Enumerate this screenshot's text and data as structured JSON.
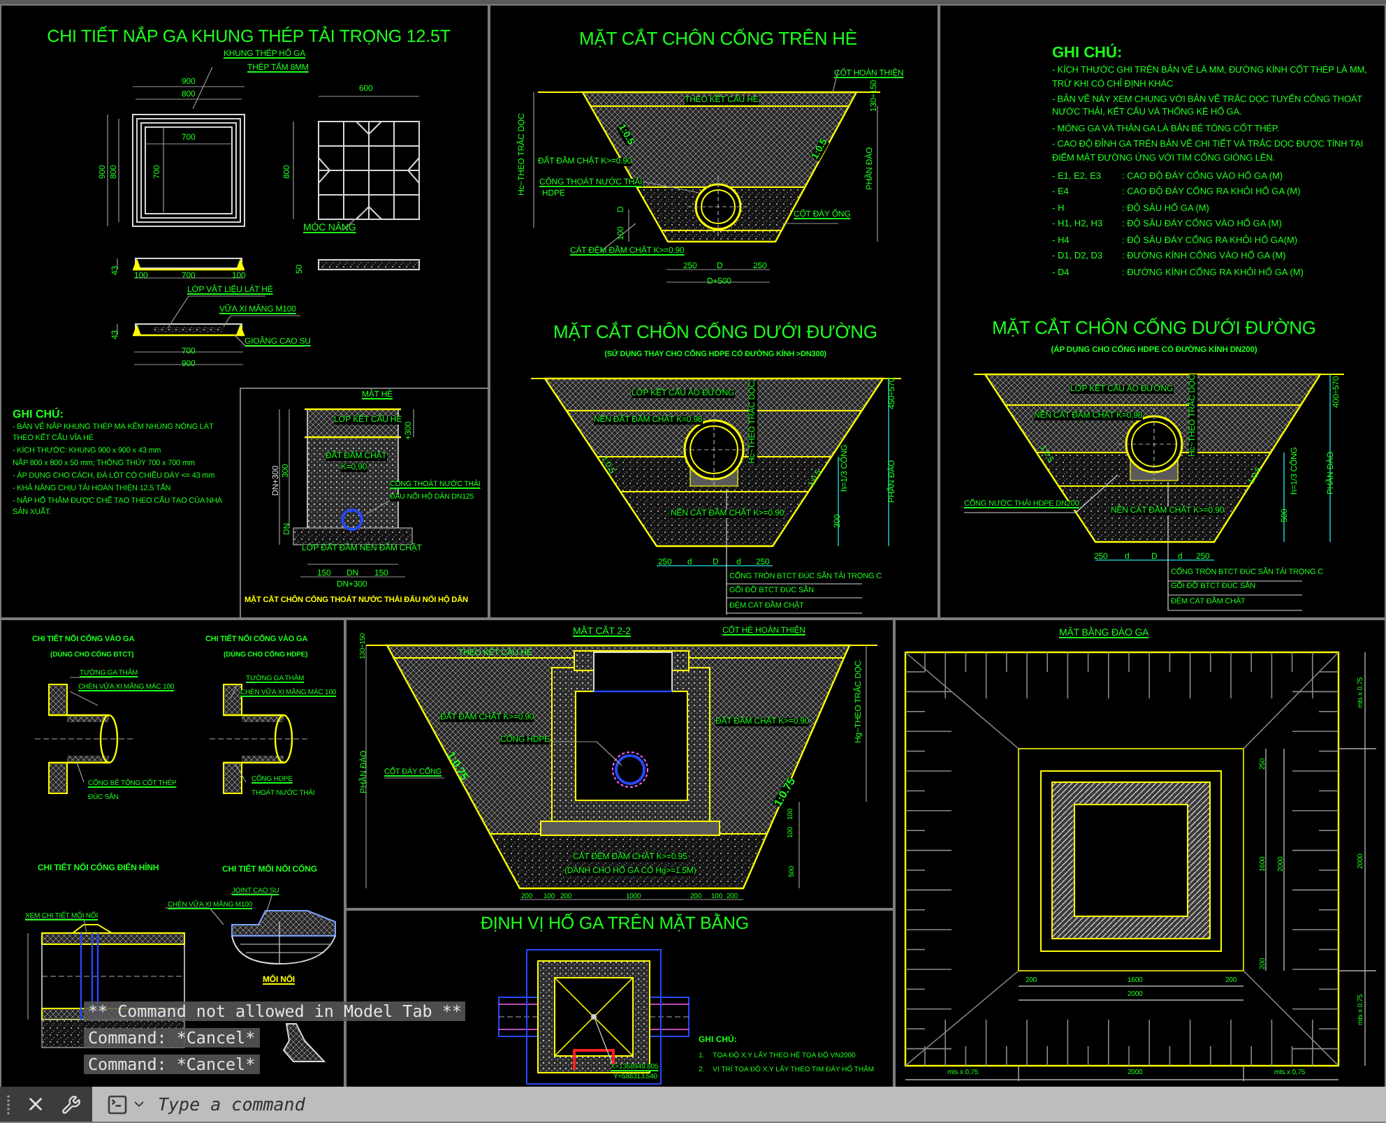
{
  "lid_detail": {
    "title": "CHI TIẾT NẮP GA KHUNG THÉP TẢI TRỌNG 12.5T",
    "labels": [
      "KHUNG THÉP HỐ GA",
      "THÉP TẤM 8MM",
      "900",
      "800",
      "700",
      "900",
      "800",
      "700",
      "600",
      "800",
      "MÓC NÂNG",
      "43",
      "100",
      "700",
      "100",
      "50",
      "LỚP VẬT LIỆU LÁT HÈ",
      "VỮA XI MĂNG M100",
      "43",
      "GIOĂNG CAO SU",
      "700",
      "900"
    ],
    "notes": {
      "heading": "GHI CHÚ:",
      "items": [
        "- BẢN VẼ NẮP KHUNG THÉP MẠ KẼM NHÚNG NÓNG LÁT THEO KẾT CẤU VỈA HÈ",
        "- KÍCH THƯỚC: KHUNG 900 x 900 x 43 mm",
        "NẮP 800 x 800 x 50 mm; THÔNG THỦY 700 x 700 mm",
        "- ÁP DỤNG CHO CÁCH, ĐÁ LÓT CÓ CHIỀU DÀY <= 43 mm",
        "- KHẢ NĂNG CHỊU TẢI HOÀN THIỆN 12,5 TẤN",
        "- NẮP HỐ THĂM ĐƯỢC CHẾ TẠO THEO CẤU TẠO CỦA NHÀ SẢN XUẤT."
      ]
    },
    "inset": {
      "title": "MẶT CẮT CHÔN CỐNG THOÁT NƯỚC THẢI ĐẤU NỐI HỘ DÂN",
      "labels": [
        "MẶT HÈ",
        "LỚP KẾT CẤU HÈ",
        "ĐẤT ĐẦM CHẶT",
        "K=0,90",
        "CỐNG THOÁT NƯỚC THẢI",
        "ĐẤU NỐI HỘ DÂN DN125",
        "LỚP ĐẤT ĐẦM NÉN ĐẦM CHẶT",
        "150",
        "DN",
        "150",
        "DN+300",
        "DN+300",
        "300",
        "DN",
        "+300"
      ]
    }
  },
  "sidewalk_section": {
    "title": "MẶT CẮT CHÔN CỐNG TRÊN HÈ",
    "labels": [
      "CỐT HOÀN THIỆN",
      "THEO KẾT CẤU HÈ",
      "130÷150",
      "Hc~THEO TRẮC DỌC",
      "1:0.5",
      "ĐẤT ĐẦM CHẶT K>=0.90",
      "CỐNG THOÁT NƯỚC THẢI",
      "HDPE",
      "1:0.5",
      "PHẦN ĐÀO",
      "CỐT ĐÁY ỐNG",
      "D",
      "100",
      "CÁT ĐỆM ĐẦM CHẶT K>=0.90",
      "250",
      "D",
      "250",
      "D+500"
    ]
  },
  "road_section": {
    "title": "MẶT CẮT CHÔN CỐNG DƯỚI ĐƯỜNG",
    "subtitle": "(SỬ DỤNG THAY CHO CỐNG HDPE CÓ ĐƯỜNG KÍNH >DN300)",
    "labels": [
      "LỚP KẾT CẤU ÁO ĐƯỜNG",
      "NỀN ĐẤT ĐẦM CHẶT K=0.98",
      "Hc~THEO TRẮC DỌC",
      "450÷570",
      "1:0.5",
      "1:0.5",
      "h=1/3 CỐNG",
      "PHẦN ĐÀO",
      "300",
      "NỀN CÁT ĐẦM CHẶT K>=0.90",
      "250",
      "d",
      "D",
      "d",
      "250",
      "CỐNG TRÒN BTCT ĐÚC SẴN TẢI TRỌNG C",
      "GỐI ĐỠ BTCT ĐÚC SẴN",
      "ĐỆM CÁT ĐẦM CHẶT"
    ]
  },
  "general_notes": {
    "heading": "GHI CHÚ:",
    "items": [
      "- KÍCH THƯỚC GHI TRÊN BẢN VẼ LÀ MM, ĐƯỜNG KÍNH CỐT THÉP LÀ MM, TRỪ KHI CÓ CHỈ ĐỊNH KHÁC",
      "- BẢN VẼ NÀY XEM CHUNG VỚI BẢN VẼ TRẮC DỌC TUYẾN CỐNG THOÁT NƯỚC THẢI, KẾT CẤU VÀ THỐNG KÊ HỐ GA.",
      "- MÓNG GA VÀ THÂN GA LÀ BẢN BÊ TÔNG CỐT THÉP.",
      "- CAO ĐỘ ĐỈNH GA TRÊN BẢN VẼ CHI TIẾT VÀ TRẮC DỌC ĐƯỢC TÍNH TẠI ĐIỂM MẶT ĐƯỜNG ỨNG VỚI TIM CỐNG GIÓNG LÊN."
    ],
    "legend": [
      {
        "term": "- E1, E2, E3",
        "definition": ": CAO ĐỘ ĐÁY CỐNG VÀO HỐ GA (M)"
      },
      {
        "term": "- E4",
        "definition": ": CAO ĐỘ ĐÁY CỐNG RA KHỎI HỐ GA (M)"
      },
      {
        "term": "- H",
        "definition": ": ĐỘ SÂU HỐ GA (M)"
      },
      {
        "term": "- H1, H2, H3",
        "definition": ": ĐỘ SÂU ĐÁY CỐNG VÀO HỐ GA (M)"
      },
      {
        "term": "- H4",
        "definition": ": ĐỘ SÂU ĐÁY CỐNG RA KHỎI HỐ GA(M)"
      },
      {
        "term": "- D1, D2, D3",
        "definition": ": ĐƯỜNG KÍNH CỐNG VÀO HỐ GA (M)"
      },
      {
        "term": "- D4",
        "definition": ": ĐƯỜNG KÍNH CỐNG RA KHỎI HỐ GA (M)"
      }
    ]
  },
  "road_section_small": {
    "title": "MẶT CẮT CHÔN CỐNG DƯỚI ĐƯỜNG",
    "subtitle": "(ÁP DỤNG CHO CỐNG HDPE CÓ ĐƯỜNG KÍNH DN200)",
    "labels": [
      "LỚP KẾT CẤU ÁO ĐƯỜNG",
      "NỀN CÁT ĐẦM CHẶT K=0,98",
      "Hc~THEO TRẮC DỌC",
      "400÷570",
      "1:0.5",
      "1:0.5",
      "h=1/3 CỐNG",
      "PHẦN ĐÀO",
      "500",
      "CỐNG NƯỚC THẢI HDPE DN200",
      "NỀN CÁT ĐẦM CHẶT K>=0.90",
      "250",
      "d",
      "D",
      "d",
      "250",
      "CỐNG TRÒN BTCT ĐÚC SẴN TẢI TRỌNG C",
      "GỐI ĐỠ BTCT ĐÚC SẴN",
      "ĐỆM CÁT ĐẦM CHẶT"
    ]
  },
  "pipe_details": {
    "labels": [
      "CHI TIẾT NỐI CỐNG VÀO GA",
      "(DÙNG CHO CỐNG BTCT)",
      "TƯỜNG GA THĂM",
      "CHÈN VỮA XI MĂNG MÁC 100",
      "CỐNG BÊ TÔNG CỐT THÉP",
      "ĐÚC SẴN",
      "CHI TIẾT NỐI CỐNG VÀO GA",
      "(DÙNG CHO CỐNG HDPE)",
      "TƯỜNG GA THĂM",
      "CHÈN VỮA XI MĂNG MÁC 100",
      "CỐNG HDPE",
      "THOÁT NƯỚC THẢI",
      "CHI TIẾT NỐI CỐNG ĐIỂN HÌNH",
      "CHI TIẾT MỐI NỐI CỐNG",
      "JOINT CAO SU",
      "CHÈN VỮA XI MĂNG M100",
      "XEM CHI TIẾT MỐI NỐI",
      "MỐI NỐI"
    ]
  },
  "section_2_2": {
    "labels": [
      "MẶT CẮT 2-2",
      "CỐT HÈ HOÀN THIỆN",
      "THEO KẾT CẤU HÈ",
      "130÷150",
      "ĐẤT ĐẦM CHẶT K>=0.90",
      "CỐNG HDPE",
      "ĐẤT ĐẦM CHẶT K>=0.90",
      "Hg~THEO TRẮC DỌC",
      "PHẦN ĐÀO",
      "CỐT ĐÁY CỐNG",
      "1:0.75",
      "1:0.75",
      "100",
      "100",
      "500",
      "CÁT ĐỆM ĐẦM CHẶT K>=0.95",
      "(DÀNH CHO HỐ GA CÓ Hg>=1.5M)",
      "200",
      "100",
      "200",
      "1000",
      "200",
      "100",
      "200"
    ]
  },
  "plan_location": {
    "title": "ĐỊNH VỊ HỐ GA TRÊN MẶT BẰNG",
    "labels": [
      "X=1358949.805",
      "Y=588313.540"
    ],
    "notes": {
      "heading": "GHI CHÚ:",
      "items": [
        {
          "number": "1.",
          "text": "TỌA ĐỘ X,Y LẤY THEO HỆ TỌA ĐỘ VN2000"
        },
        {
          "number": "2.",
          "text": "VỊ TRÍ TỌA ĐỘ X,Y LẤY THEO TIM ĐÁY HỐ THĂM"
        }
      ]
    }
  },
  "excavation_plan": {
    "labels": [
      "MẶT BẰNG ĐÀO GA",
      "mts x 0,75",
      "2000",
      "mts x 0,75",
      "250",
      "1600",
      "2000",
      "200",
      "200",
      "1600",
      "200",
      "2000",
      "mts x 0,75",
      "2000",
      "mts x 0,75"
    ]
  },
  "command_line": {
    "history": [
      "** Command not allowed in Model Tab **",
      "Command: *Cancel*",
      "Command: *Cancel*"
    ],
    "input": {
      "placeholder": "Type a command"
    }
  }
}
